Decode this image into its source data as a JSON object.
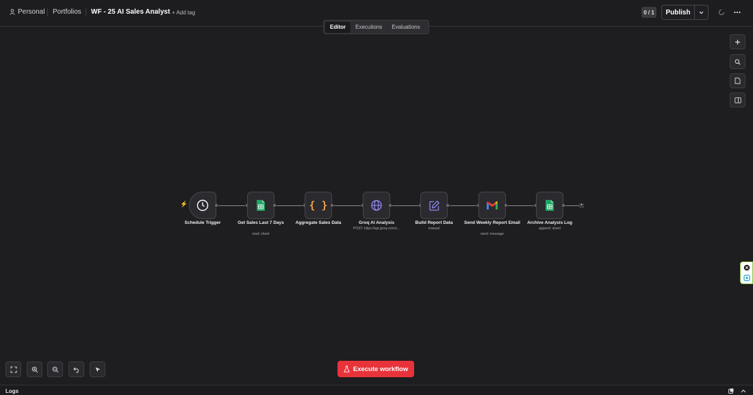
{
  "header": {
    "breadcrumb_personal": "Personal",
    "breadcrumb_portfolios": "Portfolios",
    "workflow_title": "WF - 25 AI Sales Analyst",
    "add_tag": "+ Add tag",
    "counter": "0 / 1",
    "publish_label": "Publish"
  },
  "tabs": [
    {
      "label": "Editor",
      "active": true
    },
    {
      "label": "Executions",
      "active": false
    },
    {
      "label": "Evaluations",
      "active": false
    }
  ],
  "nodes": [
    {
      "label": "Schedule Trigger",
      "sub": "",
      "icon": "clock-icon"
    },
    {
      "label": "Get Sales Last 7 Days",
      "sub": "read: sheet",
      "icon": "google-sheets-icon"
    },
    {
      "label": "Aggregate Sales Data",
      "sub": "",
      "icon": "code-braces-icon"
    },
    {
      "label": "Groq AI Analysis",
      "sub": "POST: https://api.groq.com/o...",
      "icon": "globe-icon"
    },
    {
      "label": "Build Report Data",
      "sub": "manual",
      "icon": "edit-icon"
    },
    {
      "label": "Send Weekly Report Email",
      "sub": "send: message",
      "icon": "gmail-icon"
    },
    {
      "label": "Archive Analysis Log",
      "sub": "append: sheet",
      "icon": "google-sheets-icon"
    }
  ],
  "controls": {
    "execute_label": "Execute workflow"
  },
  "footer": {
    "logs_label": "Logs"
  },
  "colors": {
    "accent": "#e8333b",
    "sheets_green": "#1fa463",
    "braces_orange": "#f0a04b",
    "ai_purple": "#8f87f1"
  }
}
